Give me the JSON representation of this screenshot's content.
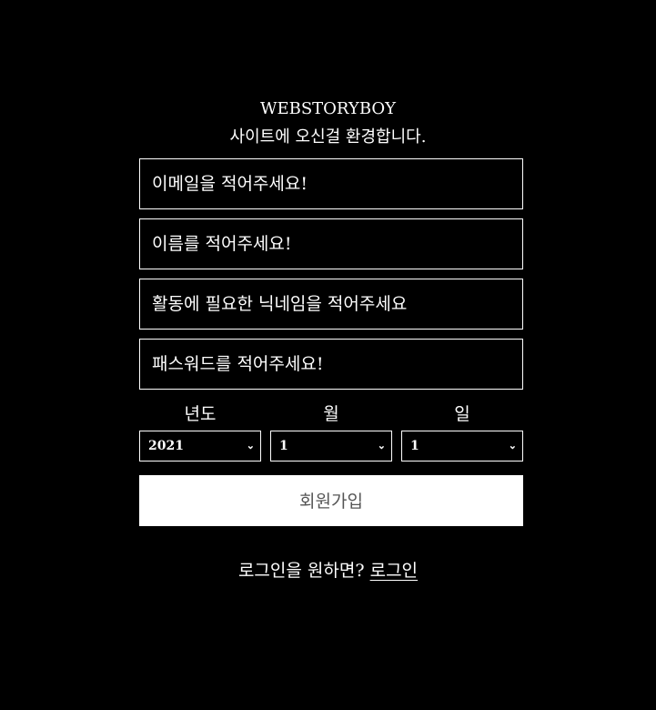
{
  "header": {
    "brand": "WEBSTORYBOY",
    "welcome": "사이트에 오신걸 환경합니다."
  },
  "form": {
    "email_placeholder": "이메일을 적어주세요!",
    "name_placeholder": "이름를 적어주세요!",
    "nickname_placeholder": "활동에 필요한 닉네임을 적어주세요",
    "password_placeholder": "패스워드를 적어주세요!",
    "year_label": "년도",
    "month_label": "월",
    "day_label": "일",
    "year_value": "2021",
    "month_value": "1",
    "day_value": "1",
    "submit_label": "회원가입"
  },
  "footer": {
    "prompt": "로그인을 원하면?",
    "login_link": "로그인"
  }
}
